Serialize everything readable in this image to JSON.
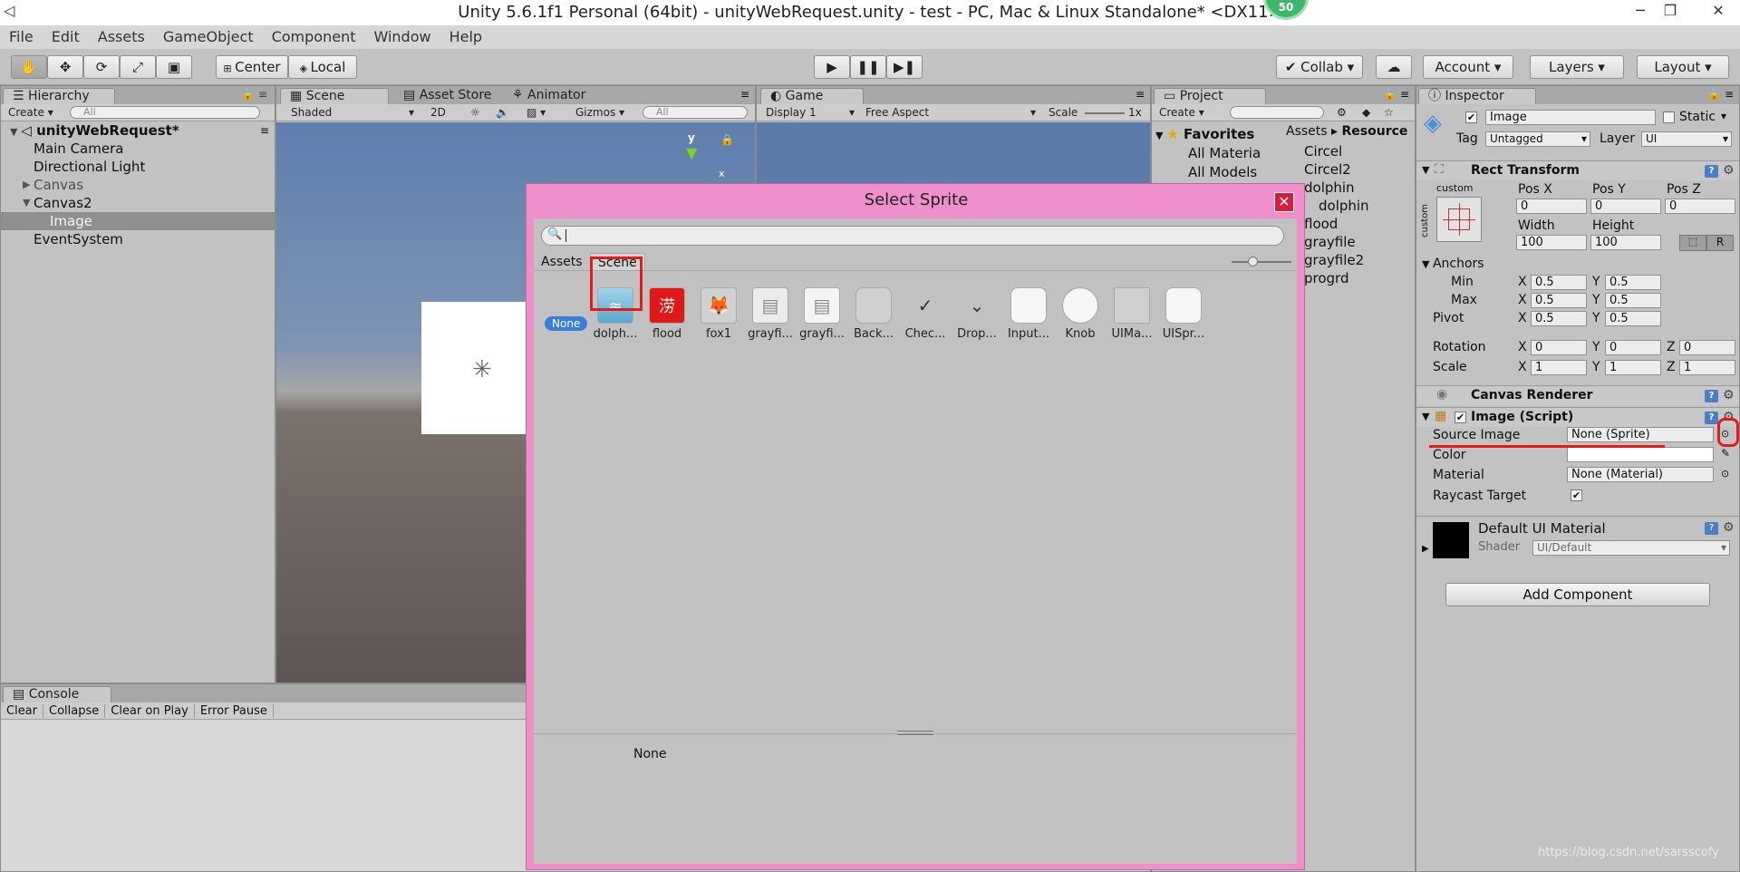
{
  "window": {
    "title": "Unity 5.6.1f1 Personal (64bit) - unityWebRequest.unity - test - PC, Mac & Linux Standalone* <DX11>",
    "badge": "50",
    "minimize": "─",
    "maximize": "❐",
    "close": "✕"
  },
  "menu": [
    "File",
    "Edit",
    "Assets",
    "GameObject",
    "Component",
    "Window",
    "Help"
  ],
  "toolbar": {
    "pivot": "Center",
    "space": "Local",
    "collab": "Collab",
    "account": "Account",
    "layers": "Layers",
    "layout": "Layout"
  },
  "hierarchy": {
    "tab": "Hierarchy",
    "create": "Create",
    "search_placeholder": "All",
    "scene": "unityWebRequest*",
    "items": [
      "Main Camera",
      "Directional Light",
      "Canvas",
      "Canvas2",
      "Image",
      "EventSystem"
    ]
  },
  "scene": {
    "tabs": [
      "Scene",
      "Asset Store",
      "Animator"
    ],
    "shading": "Shaded",
    "mode": "2D",
    "gizmos": "Gizmos",
    "search_placeholder": "All",
    "axis_y": "y",
    "axis_x": "x"
  },
  "game": {
    "tab": "Game",
    "display": "Display 1",
    "aspect": "Free Aspect",
    "scale_label": "Scale",
    "scale_value": "1x"
  },
  "project": {
    "tab": "Project",
    "create": "Create",
    "favorites": "Favorites",
    "fav_items": [
      "All Materia",
      "All Models"
    ],
    "breadcrumb": [
      "Assets",
      "Resource"
    ],
    "assets": [
      "Circel",
      "Circel2",
      "dolphin",
      "dolphin",
      "flood",
      "grayfile",
      "grayfile2",
      "progrd"
    ]
  },
  "console": {
    "tab": "Console",
    "buttons": [
      "Clear",
      "Collapse",
      "Clear on Play",
      "Error Pause"
    ]
  },
  "dialog": {
    "title": "Select Sprite",
    "tabs": [
      "Assets",
      "Scene"
    ],
    "none_label": "None",
    "thumbs": [
      "dolph...",
      "flood",
      "fox1",
      "grayfi...",
      "grayfi...",
      "Back...",
      "Chec...",
      "Drop...",
      "Input...",
      "Knob",
      "UIMa...",
      "UISpr..."
    ],
    "preview": "None"
  },
  "inspector": {
    "tab": "Inspector",
    "name": "Image",
    "static": "Static",
    "tag_label": "Tag",
    "tag_value": "Untagged",
    "layer_label": "Layer",
    "layer_value": "UI",
    "rect": {
      "title": "Rect Transform",
      "anchor_preset": "custom",
      "anchor_preset_side": "custom",
      "posx_label": "Pos X",
      "posy_label": "Pos Y",
      "posz_label": "Pos Z",
      "posx": "0",
      "posy": "0",
      "posz": "0",
      "width_label": "Width",
      "height_label": "Height",
      "width": "100",
      "height": "100",
      "raw": "R",
      "anchors": "Anchors",
      "min": "Min",
      "max": "Max",
      "pivot": "Pivot",
      "rotation": "Rotation",
      "scale": "Scale",
      "min_x": "0.5",
      "min_y": "0.5",
      "max_x": "0.5",
      "max_y": "0.5",
      "pivot_x": "0.5",
      "pivot_y": "0.5",
      "rot_x": "0",
      "rot_y": "0",
      "rot_z": "0",
      "scale_x": "1",
      "scale_y": "1",
      "scale_z": "1"
    },
    "canvas_renderer": "Canvas Renderer",
    "image_script": {
      "title": "Image (Script)",
      "source_label": "Source Image",
      "source_value": "None (Sprite)",
      "color_label": "Color",
      "material_label": "Material",
      "material_value": "None (Material)",
      "raycast_label": "Raycast Target"
    },
    "material": {
      "name": "Default UI Material",
      "shader_label": "Shader",
      "shader_value": "UI/Default"
    },
    "add_component": "Add Component"
  },
  "watermark": "https://blog.csdn.net/sarsscofy",
  "colors": {
    "dialog_bg": "#ee8fcc",
    "highlight": "#e21b1b",
    "selection": "#8f8f8f"
  }
}
